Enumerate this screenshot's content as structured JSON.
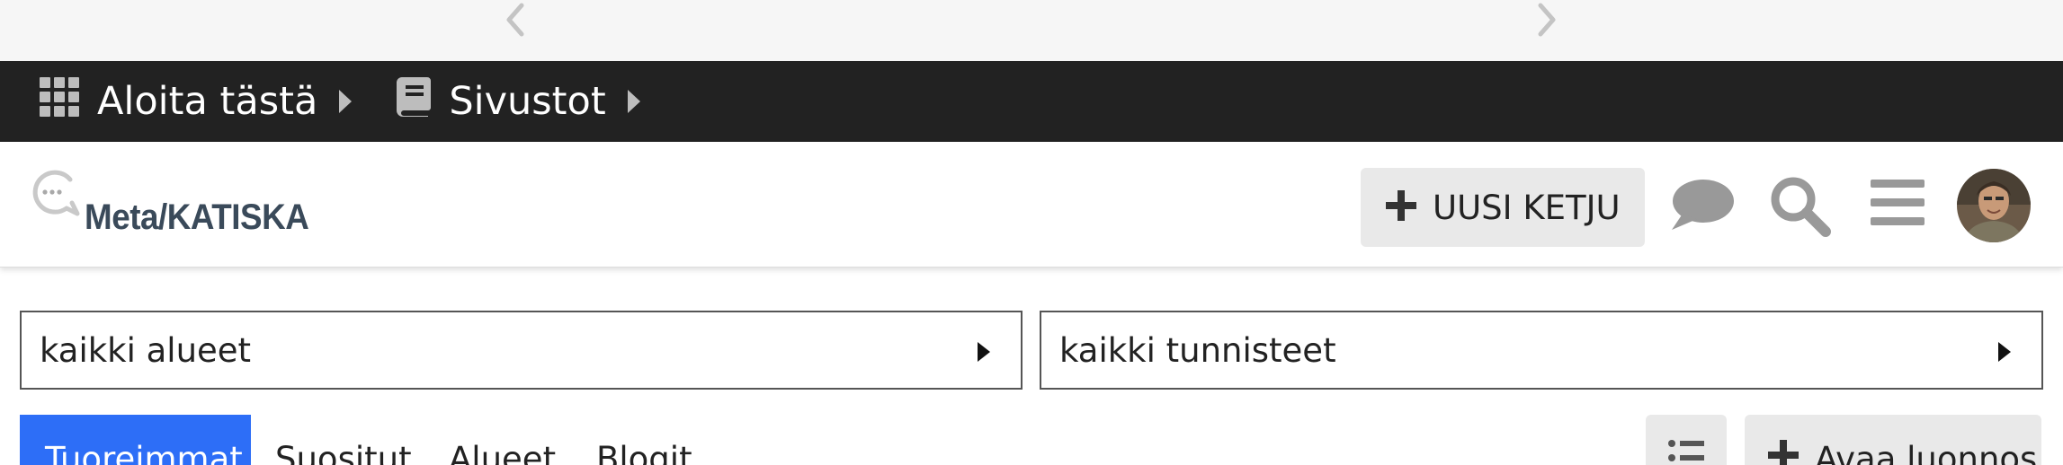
{
  "navbar": {
    "items": [
      {
        "label": "Aloita tästä",
        "icon": "grid-icon"
      },
      {
        "label": "Sivustot",
        "icon": "book-icon"
      }
    ]
  },
  "header": {
    "logo_text": "Meta/KATISKA",
    "new_thread_label": "UUSI KETJU"
  },
  "filters": {
    "areas_label": "kaikki alueet",
    "tags_label": "kaikki tunnisteet"
  },
  "tabs": [
    {
      "label": "Tuoreimmat",
      "active": true
    },
    {
      "label": "Suositut",
      "active": false
    },
    {
      "label": "Alueet",
      "active": false
    },
    {
      "label": "Blogit",
      "active": false
    }
  ],
  "actions": {
    "draft_label": "Avaa luonnos"
  },
  "colors": {
    "navbar_bg": "#222222",
    "accent": "#2d6ef7",
    "button_bg": "#e9e9e9",
    "icon_gray": "#999999"
  }
}
